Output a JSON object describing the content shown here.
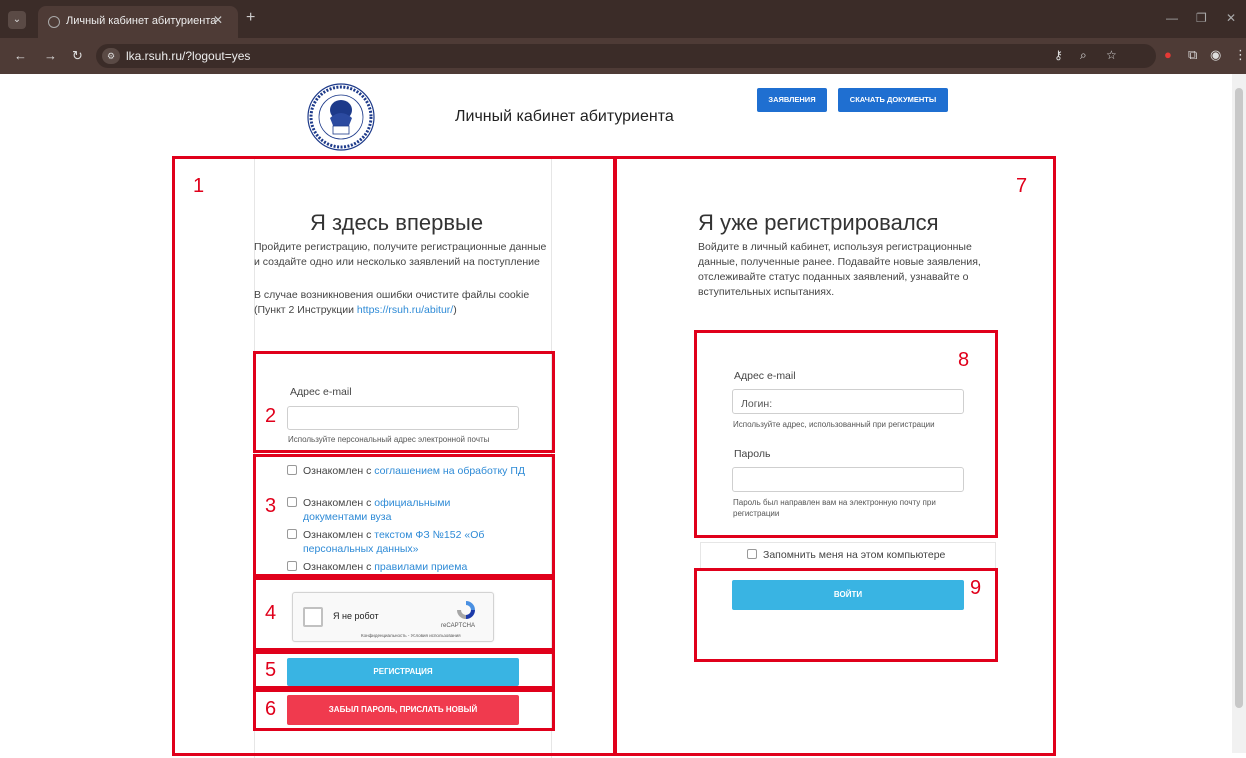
{
  "browser": {
    "tab_title": "Личный кабинет абитуриента",
    "tab_close": "✕",
    "new_tab": "+",
    "url": "lka.rsuh.ru/?logout=yes"
  },
  "header": {
    "title": "Личный кабинет абитуриента",
    "btn_applications": "ЗАЯВЛЕНИЯ",
    "btn_download": "СКАЧАТЬ ДОКУМЕНТЫ"
  },
  "left": {
    "title": "Я здесь впервые",
    "desc_line1": "Пройдите регистрацию, получите регистрационные данные",
    "desc_line2": "и создайте одно или несколько заявлений на поступление",
    "cookie_line1": "В случае возникновения ошибки очистите файлы cookie",
    "cookie_line2_prefix": "(Пункт 2 Инструкции ",
    "cookie_link": "https://rsuh.ru/abitur/",
    "cookie_line2_suffix": ")",
    "email_label": "Адрес e-mail",
    "email_value": "",
    "email_hint": "Используйте персональный адрес электронной почты",
    "checkboxes": [
      {
        "prefix": "Ознакомлен с ",
        "link": "соглашением на обработку ПД"
      },
      {
        "prefix": "Ознакомлен с ",
        "link": "официальными документами вуза"
      },
      {
        "prefix": "Ознакомлен с ",
        "link": "текстом ФЗ №152 «Об персональных данных»"
      },
      {
        "prefix": "Ознакомлен с ",
        "link": "правилами приема"
      }
    ],
    "captcha_label": "Я не робот",
    "captcha_brand": "reCAPTCHA",
    "captcha_links": "Конфиденциальность - Условия использования",
    "register_button": "РЕГИСТРАЦИЯ",
    "forgot_button": "ЗАБЫЛ ПАРОЛЬ, ПРИСЛАТЬ НОВЫЙ"
  },
  "right": {
    "title": "Я уже регистрировался",
    "desc_line1": "Войдите в личный кабинет, используя регистрационные",
    "desc_line2": "данные, полученные ранее. Подавайте новые заявления,",
    "desc_line3": "отслеживайте статус поданных заявлений, узнавайте о",
    "desc_line4": "вступительных испытаниях.",
    "email_label": "Адрес e-mail",
    "login_placeholder": "Логин:",
    "email_hint": "Используйте адрес, использованный при регистрации",
    "password_label": "Пароль",
    "password_value": "",
    "password_hint_line1": "Пароль был направлен вам на электронную почту при",
    "password_hint_line2": "регистрации",
    "remember_label": "Запомнить меня на этом компьютере",
    "login_button": "ВОЙТИ"
  },
  "annotations": [
    "1",
    "2",
    "3",
    "4",
    "5",
    "6",
    "7",
    "8",
    "9"
  ],
  "colors": {
    "annotation": "#e0001b",
    "primary_blue": "#1f6fd1",
    "button_light_blue": "#39b4e3",
    "button_red": "#f03a4e",
    "link": "#2d8ad6"
  }
}
